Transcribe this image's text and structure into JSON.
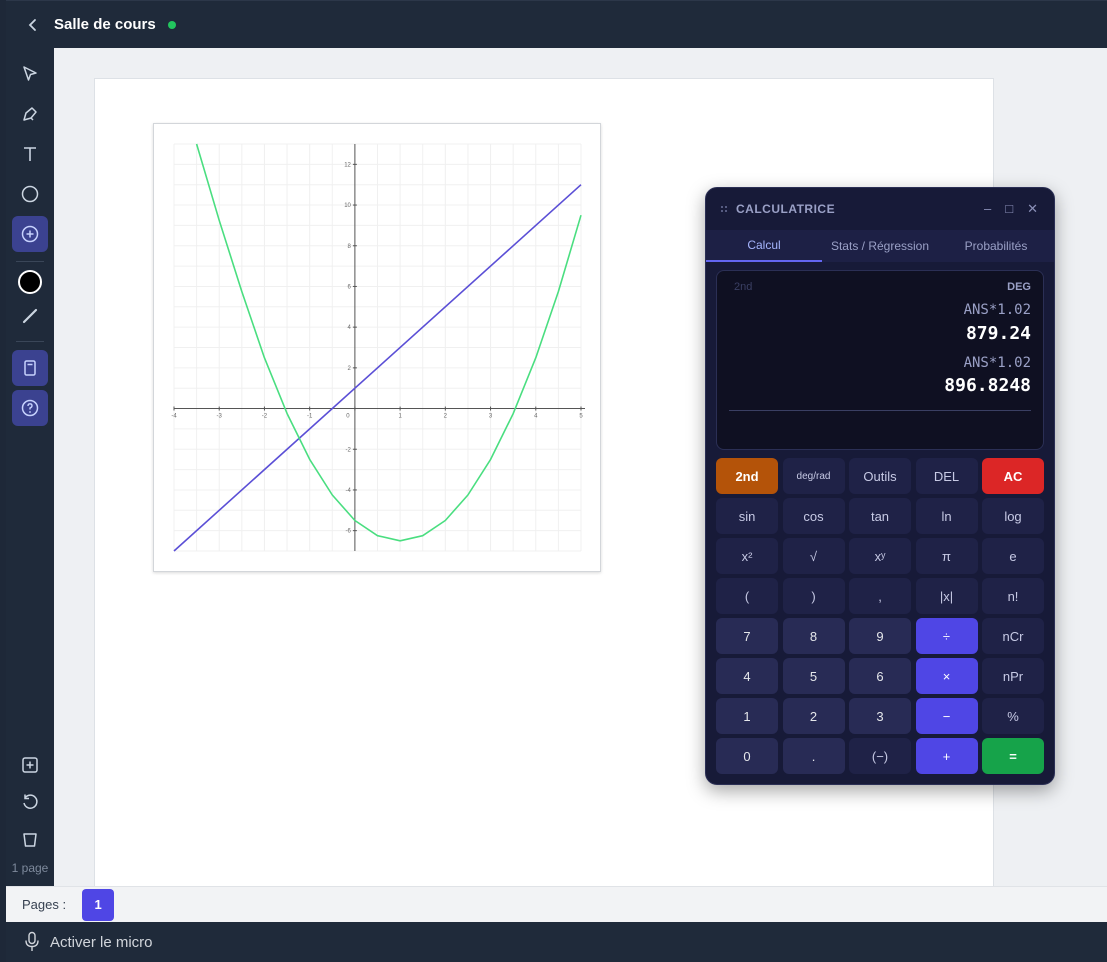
{
  "header": {
    "title": "Salle de cours"
  },
  "sidebar": {
    "page_count": "1 page"
  },
  "graph": {
    "x_ticks": [
      "-4",
      "-3",
      "-2",
      "-1",
      "0",
      "1",
      "2",
      "3",
      "4",
      "5"
    ],
    "y_ticks": [
      "12",
      "10",
      "8",
      "6",
      "4",
      "2",
      "-2",
      "-4",
      "-6"
    ],
    "colors": {
      "line": "#5b4fd6",
      "parabola": "#4ade80"
    }
  },
  "chart_data": {
    "type": "line",
    "x_range": [
      -4,
      5
    ],
    "y_range": [
      -7,
      13
    ],
    "grid": true,
    "series": [
      {
        "x": [
          -4,
          5
        ],
        "y": [
          -7,
          11
        ]
      },
      {
        "x": [
          -3.5,
          -3,
          -2.5,
          -2,
          -1.5,
          -1,
          -0.5,
          0,
          0.5,
          1,
          1.5,
          2,
          2.5,
          3,
          3.5,
          4,
          4.5,
          5
        ],
        "y": [
          13,
          9.25,
          5.75,
          2.5,
          -0.25,
          -2.5,
          -4.25,
          -5.5,
          -6.25,
          -6.5,
          -6.25,
          -5.5,
          -4.25,
          -2.5,
          -0.25,
          2.5,
          5.75,
          9.5
        ]
      }
    ]
  },
  "calculator": {
    "title": "CALCULATRICE",
    "tabs": [
      "Calcul",
      "Stats / Régression",
      "Probabilités"
    ],
    "display": {
      "second_indicator": "2nd",
      "mode": "DEG",
      "history": [
        {
          "expr": "ANS*1.02",
          "result": "879.24"
        },
        {
          "expr": "ANS*1.02",
          "result": "896.8248"
        }
      ]
    },
    "keys": [
      [
        "2nd",
        "deg/rad",
        "Outils",
        "DEL",
        "AC"
      ],
      [
        "sin",
        "cos",
        "tan",
        "ln",
        "log"
      ],
      [
        "x²",
        "√",
        "xʸ",
        "π",
        "e"
      ],
      [
        "(",
        ")",
        ",",
        "|x|",
        "n!"
      ],
      [
        "7",
        "8",
        "9",
        "÷",
        "nCr"
      ],
      [
        "4",
        "5",
        "6",
        "×",
        "nPr"
      ],
      [
        "1",
        "2",
        "3",
        "−",
        "%"
      ],
      [
        "0",
        ".",
        "(−)",
        "+",
        "="
      ]
    ],
    "colors": {
      "accent": "#4f46e5",
      "second": "#b45309",
      "clear": "#dc2626",
      "equals": "#16a34a"
    }
  },
  "pages": {
    "label": "Pages :",
    "current": "1"
  },
  "mic": {
    "label": "Activer le micro"
  }
}
